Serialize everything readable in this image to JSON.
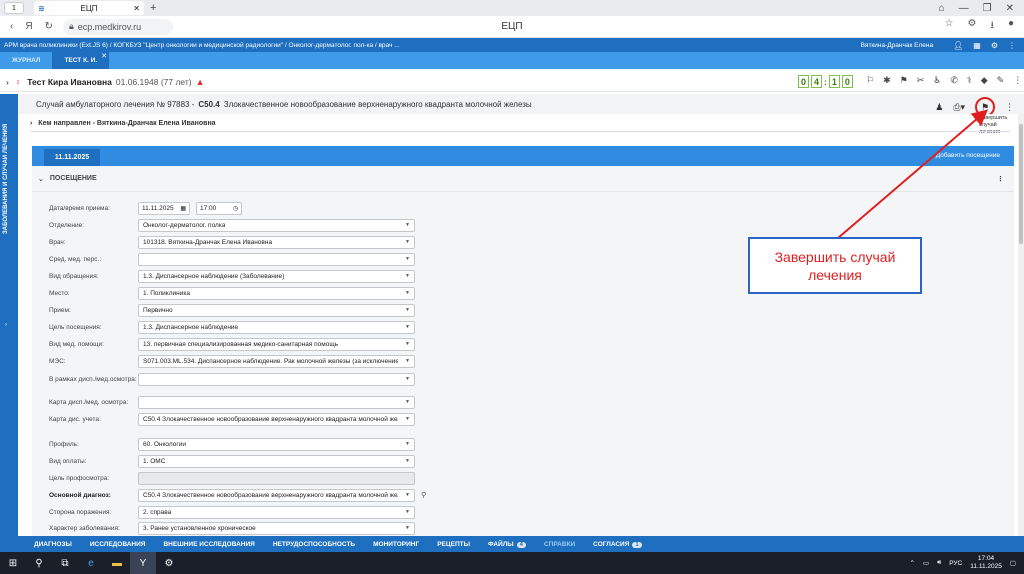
{
  "browser": {
    "tab_count": "1",
    "tab_title": "ЕЦП",
    "url": "ecp.medkirov.ru",
    "page_title": "ЕЦП"
  },
  "app_header": {
    "breadcrumb": "АРМ врача поликлиники (Ext.JS 6) / КОГКБУЗ \"Центр онкологии и медицинской радиологии\" / Онколог-дерматолог. пол-ка / врач ...",
    "user": "Вяткина-Дранчак Елена"
  },
  "journal_tabs": [
    {
      "label": "ЖУРНАЛ"
    },
    {
      "label": "ТЕСТ К. И."
    }
  ],
  "patient": {
    "name": "Тест Кира Ивановна",
    "dob": "01.06.1948 (77 лет)",
    "timer": [
      "0",
      "4",
      "1",
      "0"
    ]
  },
  "leftbar": {
    "label": "ЗАБОЛЕВАНИЯ И СЛУЧАИ ЛЕЧЕНИЯ"
  },
  "case": {
    "title_prefix": "Случай амбулаторного лечения № 97883 -",
    "diagnosis_code": "C50.4",
    "diagnosis_text": "Злокачественное новообразование верхненаружного квадранта молочной железы",
    "finish_tooltip": "Завершить случай лечения"
  },
  "referral": {
    "label": "Кем направлен - Вяткина-Дранчак Елена Ивановна"
  },
  "datebar": {
    "date": "11.11.2025",
    "add_visit": "Добавить посещение"
  },
  "visit": {
    "section_title": "ПОСЕЩЕНИЕ",
    "date_label": "Дата/время приема:",
    "date_value": "11.11.2025",
    "time_value": "17:00",
    "fields": [
      {
        "label": "Отделение:",
        "value": "Онколог-дерматолог. полка"
      },
      {
        "label": "Врач:",
        "value": "101318. Вяткина-Дранчак Елена Ивановна"
      },
      {
        "label": "Сред. мед. перс.:",
        "value": ""
      },
      {
        "label": "Вид обращения:",
        "value": "1.3. Диспансерное наблюдение (Заболевание)"
      },
      {
        "label": "Место:",
        "value": "1. Поликлиника"
      },
      {
        "label": "Прием:",
        "value": "Первично"
      },
      {
        "label": "Цель посещения:",
        "value": "1.3. Диспансерное наблюдение"
      },
      {
        "label": "Вид мед. помощи:",
        "value": "13. первичная специализированная медико-санитарная помощь"
      },
      {
        "label": "МЭС:",
        "value": "S071.003.ML.534. Диспансерное наблюдение. Рак молочной железы (за исключением"
      },
      {
        "label": "В рамках дисп./мед.осмотра:",
        "value": ""
      },
      {
        "label": "Карта дисп./мед. осмотра:",
        "value": ""
      },
      {
        "label": "Карта дис. учета:",
        "value": "C50.4 Злокачественное новообразование верхненаружного квадранта молочной желе"
      },
      {
        "label": "Профиль:",
        "value": "60. Онкологии"
      },
      {
        "label": "Вид оплаты:",
        "value": "1. ОМС"
      },
      {
        "label": "Цель профосмотра:",
        "value": ""
      },
      {
        "label": "Основной диагноз:",
        "value": "C50.4 Злокачественное новообразование верхненаружного квадранта молочной желе"
      },
      {
        "label": "Сторона поражения:",
        "value": "2. справа"
      },
      {
        "label": "Характер заболевания:",
        "value": "3. Ранее установленное хроническое"
      }
    ]
  },
  "annotation": {
    "text": "Завершить случай лечения"
  },
  "bottom_nav": [
    {
      "label": "ДИАГНОЗЫ"
    },
    {
      "label": "ИССЛЕДОВАНИЯ"
    },
    {
      "label": "ВНЕШНИЕ ИССЛЕДОВАНИЯ"
    },
    {
      "label": "НЕТРУДОСПОСОБНОСТЬ"
    },
    {
      "label": "МОНИТОРИНГ"
    },
    {
      "label": "РЕЦЕПТЫ"
    },
    {
      "label": "ФАЙЛЫ",
      "badge": "4"
    },
    {
      "label": "СПРАВКИ"
    },
    {
      "label": "СОГЛАСИЯ",
      "badge": "1"
    }
  ],
  "taskbar": {
    "lang": "РУС",
    "time": "17:04",
    "date": "11.11.2025"
  }
}
